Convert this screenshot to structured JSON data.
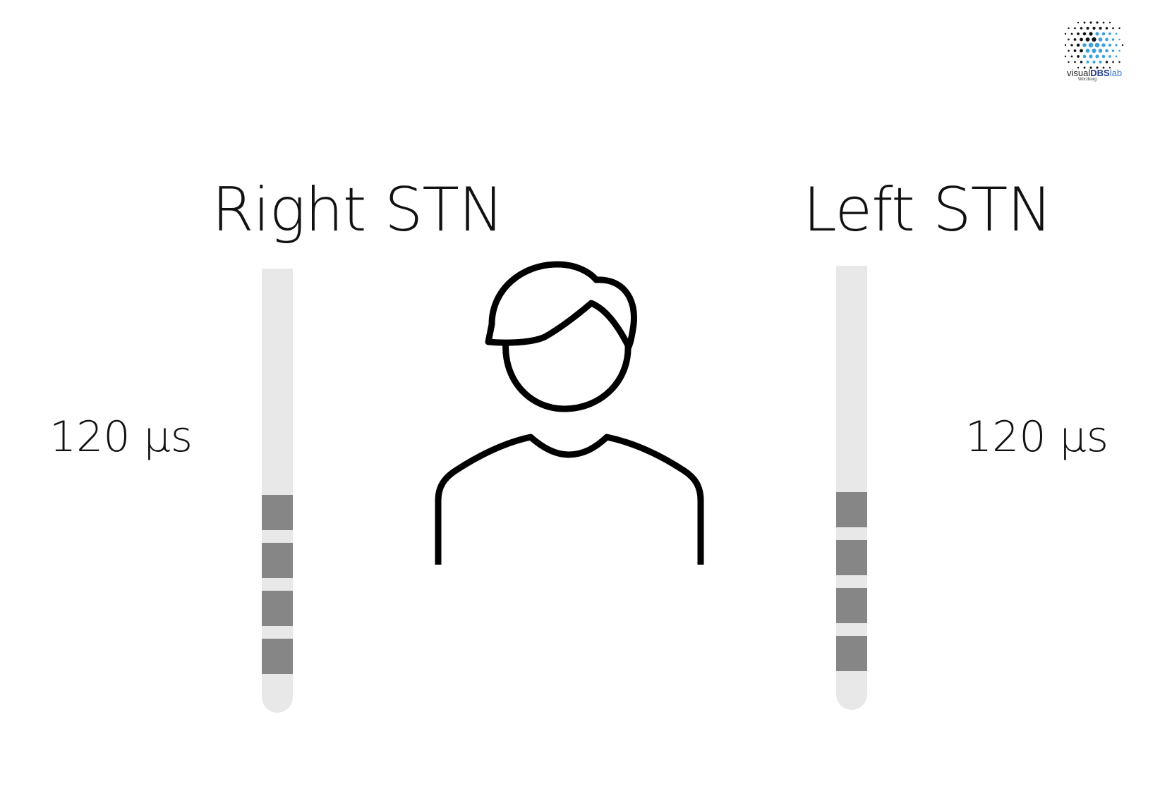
{
  "titles": {
    "right": "Right STN",
    "left": "Left STN"
  },
  "pulse_width": {
    "right": "120 µs",
    "left": "120 µs"
  },
  "logo": {
    "brand_prefix": "visual",
    "brand_bold": "DBS",
    "brand_suffix": "lab",
    "location": "Würzburg"
  },
  "leads": {
    "right": {
      "contacts": 4,
      "active_contacts": []
    },
    "left": {
      "contacts": 4,
      "active_contacts": []
    }
  },
  "colors": {
    "lead_shaft": "#e8e8e8",
    "contact": "#868686",
    "text": "#111111"
  },
  "icons": [
    "person-outline-icon",
    "visualdbslab-logo-icon"
  ]
}
